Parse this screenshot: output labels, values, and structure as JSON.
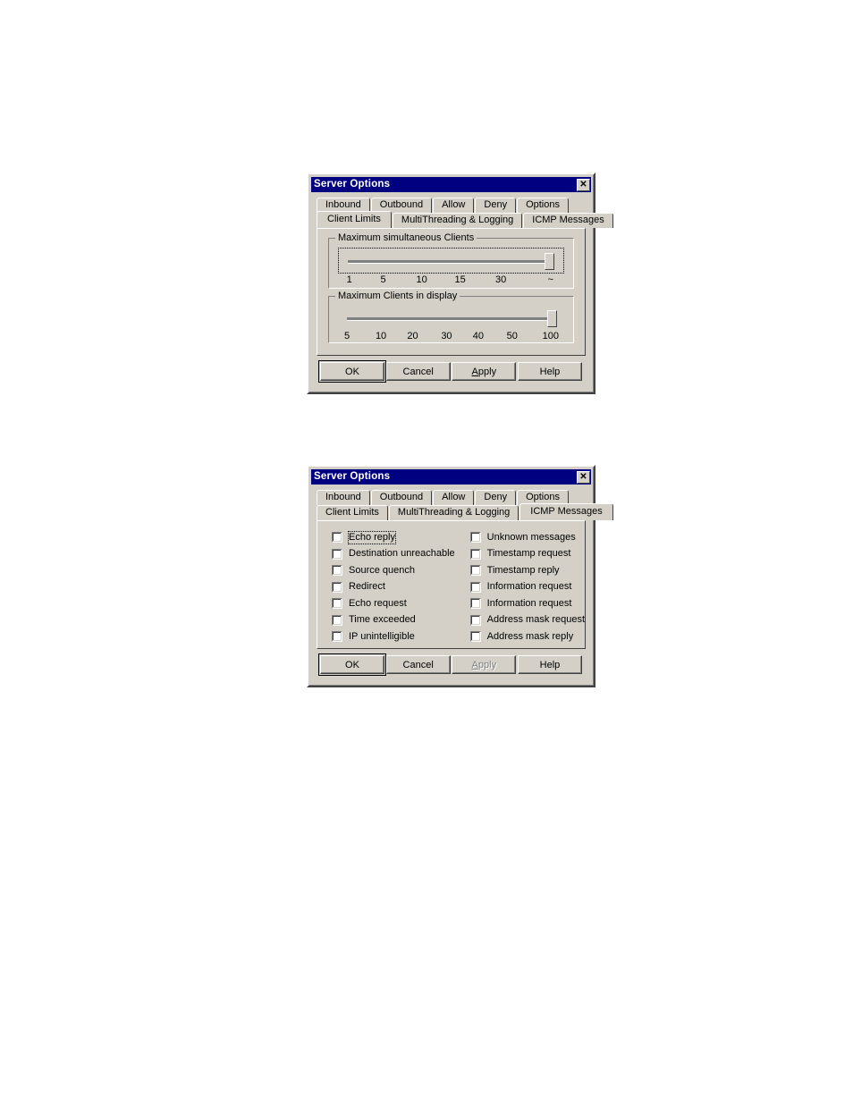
{
  "colors": {
    "titlebar": "#000080",
    "face": "#d4d0c8",
    "shadow": "#808080",
    "page_background": "#ffffff"
  },
  "dialogs": [
    {
      "id": "client-limits",
      "title": "Server Options",
      "close_label": "✕",
      "tabs_row1": [
        {
          "label": "Inbound",
          "active": false
        },
        {
          "label": "Outbound",
          "active": false
        },
        {
          "label": "Allow",
          "active": false
        },
        {
          "label": "Deny",
          "active": false
        },
        {
          "label": "Options",
          "active": false
        }
      ],
      "tabs_row2": [
        {
          "label": "Client Limits",
          "active": true
        },
        {
          "label": "MultiThreading & Logging",
          "active": false
        },
        {
          "label": "ICMP Messages",
          "active": false
        }
      ],
      "groups": [
        {
          "title": "Maximum simultaneous Clients",
          "focused": true,
          "thumb_percent": 94,
          "ticks": [
            "1",
            "5",
            "10",
            "15",
            "30",
            "~"
          ],
          "tick_positions": [
            5,
            20,
            37,
            54,
            72,
            94
          ]
        },
        {
          "title": "Maximum Clients in display",
          "focused": false,
          "thumb_percent": 95,
          "ticks": [
            "5",
            "10",
            "20",
            "30",
            "40",
            "50",
            "100"
          ],
          "tick_positions": [
            4,
            19,
            33,
            48,
            62,
            77,
            94
          ]
        }
      ],
      "buttons": [
        {
          "name": "ok",
          "label": "OK",
          "default": true,
          "disabled": false
        },
        {
          "name": "cancel",
          "label": "Cancel",
          "default": false,
          "disabled": false
        },
        {
          "name": "apply",
          "label": "Apply",
          "default": false,
          "disabled": false,
          "accel": "A"
        },
        {
          "name": "help",
          "label": "Help",
          "default": false,
          "disabled": false
        }
      ]
    },
    {
      "id": "icmp-messages",
      "title": "Server Options",
      "close_label": "✕",
      "tabs_row1": [
        {
          "label": "Inbound",
          "active": false
        },
        {
          "label": "Outbound",
          "active": false
        },
        {
          "label": "Allow",
          "active": false
        },
        {
          "label": "Deny",
          "active": false
        },
        {
          "label": "Options",
          "active": false
        }
      ],
      "tabs_row2": [
        {
          "label": "Client Limits",
          "active": false
        },
        {
          "label": "MultiThreading & Logging",
          "active": false
        },
        {
          "label": "ICMP Messages",
          "active": true
        }
      ],
      "checkboxes_left": [
        {
          "label": "Echo reply",
          "checked": false,
          "focused": true
        },
        {
          "label": "Destination unreachable",
          "checked": false,
          "focused": false
        },
        {
          "label": "Source quench",
          "checked": false,
          "focused": false
        },
        {
          "label": "Redirect",
          "checked": false,
          "focused": false
        },
        {
          "label": "Echo request",
          "checked": false,
          "focused": false
        },
        {
          "label": "Time exceeded",
          "checked": false,
          "focused": false
        },
        {
          "label": "IP unintelligible",
          "checked": false,
          "focused": false
        }
      ],
      "checkboxes_right": [
        {
          "label": "Unknown messages",
          "checked": false,
          "focused": false
        },
        {
          "label": "Timestamp request",
          "checked": false,
          "focused": false
        },
        {
          "label": "Timestamp reply",
          "checked": false,
          "focused": false
        },
        {
          "label": "Information request",
          "checked": false,
          "focused": false
        },
        {
          "label": "Information request",
          "checked": false,
          "focused": false
        },
        {
          "label": "Address mask request",
          "checked": false,
          "focused": false
        },
        {
          "label": "Address mask reply",
          "checked": false,
          "focused": false
        }
      ],
      "buttons": [
        {
          "name": "ok",
          "label": "OK",
          "default": true,
          "disabled": false
        },
        {
          "name": "cancel",
          "label": "Cancel",
          "default": false,
          "disabled": false
        },
        {
          "name": "apply",
          "label": "Apply",
          "default": false,
          "disabled": true,
          "accel": "A"
        },
        {
          "name": "help",
          "label": "Help",
          "default": false,
          "disabled": false
        }
      ]
    }
  ]
}
